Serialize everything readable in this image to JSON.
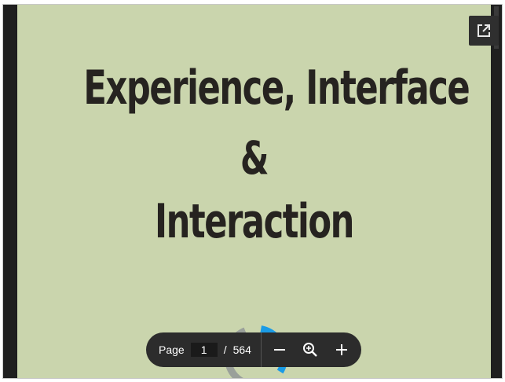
{
  "document": {
    "title_line1": "Experience, Interface",
    "title_line2": "&",
    "title_line3": "Interaction"
  },
  "toolbar": {
    "page_label": "Page",
    "current_page": "1",
    "separator": "/",
    "total_pages": "564"
  },
  "colors": {
    "page_background": "#cad5ad",
    "title_text": "#262320",
    "viewer_background": "#1f1f1f",
    "toolbar_background": "#2c2c2c",
    "spinner_accent": "#1a9be6"
  },
  "icons": {
    "popout": "open-in-new-window-icon",
    "zoom_out": "minus-icon",
    "zoom_reset": "zoom-magnifier-icon",
    "zoom_in": "plus-icon",
    "loading": "loading-spinner-icon"
  }
}
